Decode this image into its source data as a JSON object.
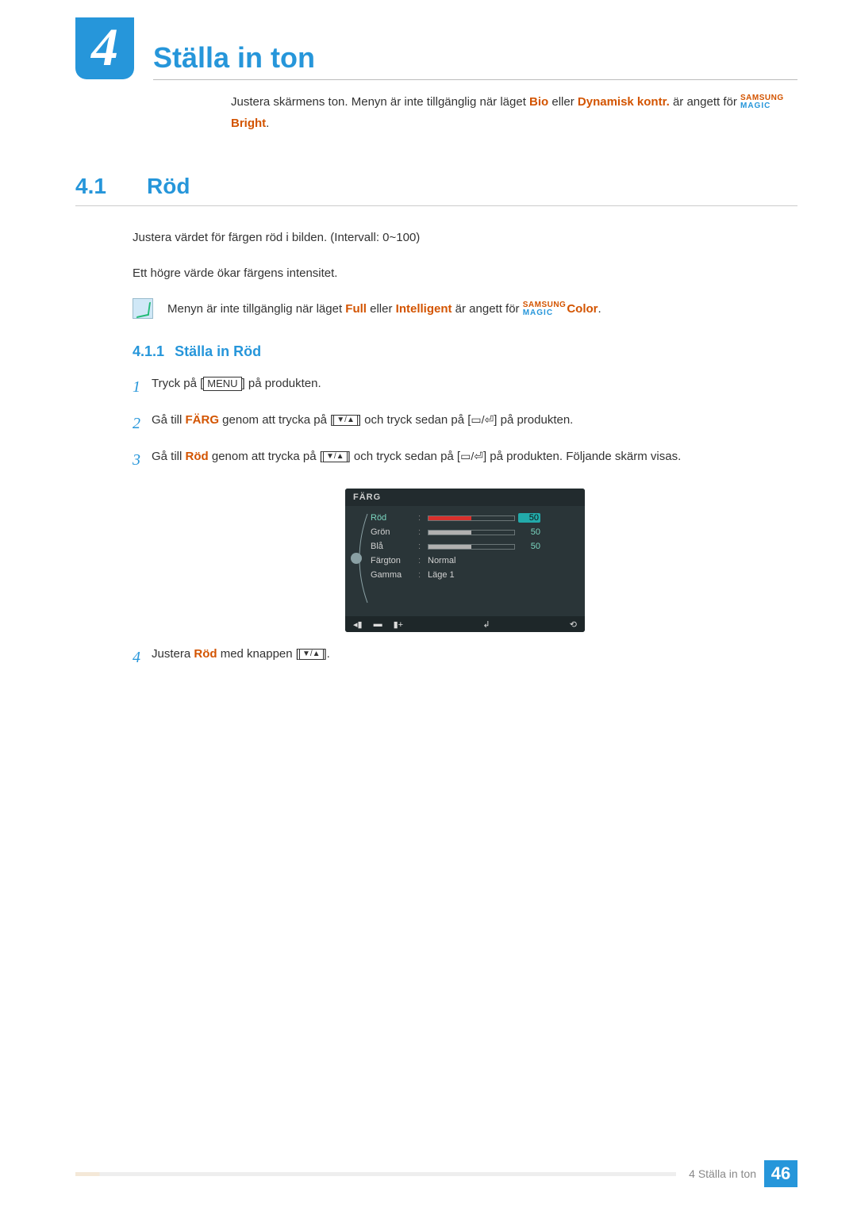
{
  "chapter": {
    "number": "4",
    "title": "Ställa in ton"
  },
  "intro": {
    "plain1": "Justera skärmens ton. Menyn är inte tillgänglig när läget ",
    "bio": "Bio",
    "eller1": " eller ",
    "dyn": "Dynamisk kontr.",
    "plain2": " är angett för ",
    "magic_top": "SAMSUNG",
    "magic_bot": "MAGIC",
    "bright": "Bright",
    "dot": "."
  },
  "section": {
    "num": "4.1",
    "title": "Röd"
  },
  "body": {
    "p1": "Justera värdet för färgen röd i bilden. (Intervall: 0~100)",
    "p2": "Ett högre värde ökar färgens intensitet."
  },
  "note": {
    "pre": "Menyn är inte tillgänglig när läget ",
    "full": "Full",
    "eller": " eller ",
    "intel": "Intelligent",
    "post": " är angett för ",
    "color": "Color",
    "dot": "."
  },
  "subsection": {
    "num": "4.1.1",
    "title": "Ställa in Röd"
  },
  "steps": {
    "s1": {
      "n": "1",
      "pre": "Tryck på [",
      "menu": "MENU",
      "post": "] på produkten."
    },
    "s2": {
      "n": "2",
      "pre": "Gå till ",
      "farg": "FÄRG",
      "mid1": " genom att trycka på [",
      "mid2": "] och tryck sedan på [",
      "mid3": "] på produkten."
    },
    "s3": {
      "n": "3",
      "pre": "Gå till ",
      "rod": "Röd",
      "mid1": " genom att trycka på [",
      "mid2": "] och tryck sedan på [",
      "mid3": "] på produkten. Följande skärm visas."
    },
    "s4": {
      "n": "4",
      "pre": "Justera ",
      "rod": "Röd",
      "post": " med knappen [",
      "end": "]."
    }
  },
  "osd": {
    "title": "FÄRG",
    "rows": [
      {
        "label": "Röd",
        "value": "50",
        "fill": 50,
        "color": "#d9302c",
        "selected": true
      },
      {
        "label": "Grön",
        "value": "50",
        "fill": 50,
        "color": "#b0b0b0",
        "selected": false
      },
      {
        "label": "Blå",
        "value": "50",
        "fill": 50,
        "color": "#b0b0b0",
        "selected": false
      },
      {
        "label": "Färgton",
        "text": "Normal"
      },
      {
        "label": "Gamma",
        "text": "Läge 1"
      }
    ],
    "footer_left": [
      "◂▮",
      "▬",
      "▮+"
    ],
    "footer_mid": "↲",
    "footer_right": "⟲"
  },
  "footer": {
    "text": "4 Ställa in ton",
    "page": "46"
  }
}
